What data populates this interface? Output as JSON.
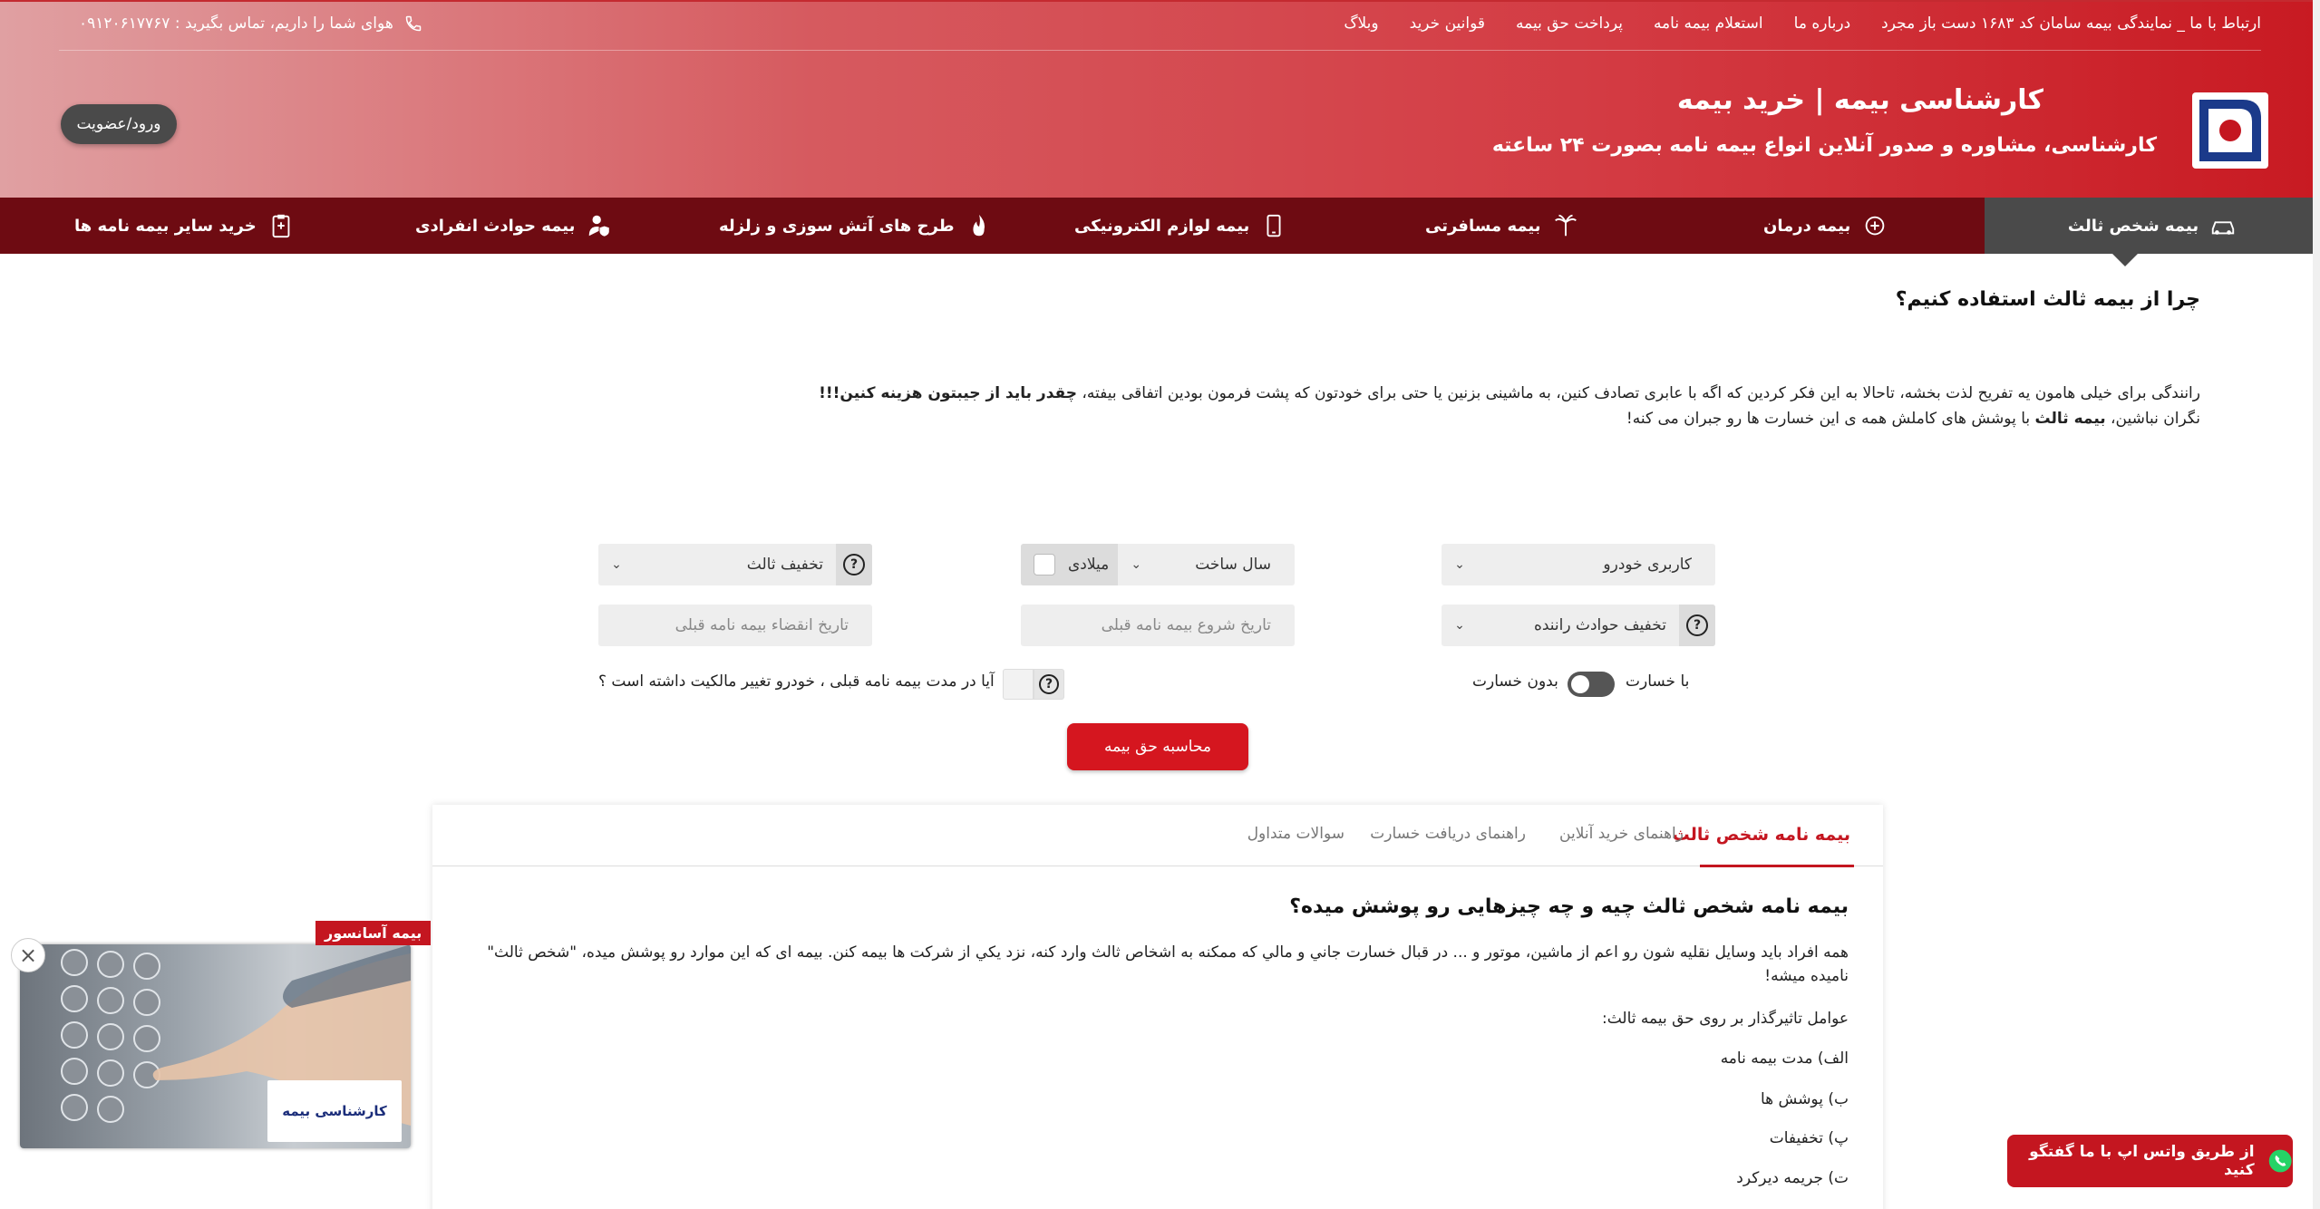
{
  "topnav": {
    "items": [
      "وبلاگ",
      "قوانین خرید",
      "پرداخت حق بیمه",
      "استعلام بیمه نامه",
      "درباره ما",
      "ارتباط با ما _ نمایندگی بیمه سامان کد ۱۶۸۳ دست باز مجرد"
    ],
    "phone_text": "هوای شما را داریم، تماس بگیرید : ۰۹۱۲۰۶۱۷۷۶۷"
  },
  "brand": {
    "title": "کارشناسی بیمه | خرید بیمه",
    "subtitle": "کارشناسی، مشاوره و صدور آنلاین انواع بیمه نامه بصورت ۲۴ ساعته"
  },
  "login_label": "ورود/عضویت",
  "mainnav": {
    "items": [
      {
        "label": "بیمه شخص ثالث",
        "icon": "car-icon"
      },
      {
        "label": "بیمه درمان",
        "icon": "health-icon"
      },
      {
        "label": "بیمه مسافرتی",
        "icon": "palm-icon"
      },
      {
        "label": "بیمه لوازم الکترونیکی",
        "icon": "phone-icon"
      },
      {
        "label": "طرح های آتش سوزی و زلزله",
        "icon": "fire-icon"
      },
      {
        "label": "بیمه حوادث انفرادی",
        "icon": "person-shield-icon"
      },
      {
        "label": "خرید سایر بیمه نامه ها",
        "icon": "clipboard-icon"
      }
    ]
  },
  "why": {
    "title": "چرا از بیمه ثالث استفاده کنیم؟",
    "line1_pre": "رانندگی برای خیلی هامون یه تفریح لذت بخشه، تاحالا به این فکر کردین که اگه با عابری تصادف کنین، به ماشینی بزنین یا حتی برای خودتون که پشت فرمون بودین اتفاقی بیفته، ",
    "line1_bold": "چقدر باید از جیبتون هزینه کنین!!!",
    "line2_pre": "نگران نباشین، ",
    "line2_bold": "بیمه ثالث",
    "line2_post": " با پوشش های کاملش همه ی این خسارت ها رو جبران می کنه!"
  },
  "form": {
    "usage": "کاربری خودرو",
    "build_year": "سال ساخت",
    "gregorian": "میلادی",
    "third_party_discount": "تخفیف ثالث",
    "driver_discount": "تخفیف حوادث راننده",
    "start_date_placeholder": "تاریخ شروع بیمه نامه قبلی",
    "expiry_date_placeholder": "تاریخ انقضاء بیمه نامه قبلی",
    "with_damage": "با خسارت",
    "without_damage": "بدون خسارت",
    "ownership_question": "آیا در مدت بیمه نامه قبلی ، خودرو تغییر مالکیت داشته است ؟",
    "calculate": "محاسبه حق بیمه"
  },
  "tabs": [
    "بیمه نامه شخص ثالث",
    "راهنمای خرید آنلاین",
    "راهنمای دریافت خسارت",
    "سوالات متداول"
  ],
  "content": {
    "title": "بیمه نامه شخص ثالث چیه و چه چیزهایی رو پوشش میده؟",
    "paragraph": "همه افراد بايد وسايل نقليه شون رو اعم از ماشين، موتور و ... در قبال خسارت جاني و مالي كه ممكنه به اشخاص ثالث وارد كنه، نزد يكي از شركت ها بيمه كنن. بیمه ای که این موارد رو پوشش میده، \"شخص ثالث\" نامیده میشه!",
    "factors_title": "عوامل تاثيرگذار بر روی حق بيمه ثالث:",
    "factors": [
      "الف) مدت بيمه نامه",
      "ب) پوشش ها",
      "پ) تخفيفات",
      "ت) جريمه ديركرد"
    ]
  },
  "ad": {
    "label": "بیمه آسانسور",
    "logo_text": "کارشناسی بیمه"
  },
  "whatsapp_label": "از طریق واتس اپ با ما گفتگو کنید",
  "colors": {
    "brand_red": "#c41620",
    "nav_dark": "#6e0b12",
    "active_tab": "#4a4a4a"
  }
}
